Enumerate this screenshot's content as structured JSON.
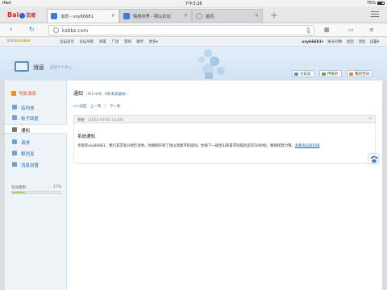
{
  "status_bar": {
    "device": "iPad",
    "time": "下午3:26",
    "battery": "75%"
  },
  "browser": {
    "logo": {
      "bai": "Bai",
      "du": "百度"
    },
    "tabs": [
      {
        "label": "消息 - sxy66681",
        "favicon": "page-icon",
        "color": "#3b7bd8",
        "active": true
      },
      {
        "label": "情感世界 - 昆山论坛",
        "favicon": "page-icon",
        "color": "#3b7bd8",
        "active": false
      },
      {
        "label": "首页",
        "favicon": "globe-icon",
        "color": "#999999",
        "active": false
      }
    ],
    "add_tab": "+",
    "url": "ksbbs.com"
  },
  "site_nav": {
    "brand": "KUNSHAN",
    "links": [
      "论坛首页",
      "论坛导航",
      "商家",
      "广场",
      "游戏",
      "群币",
      "更多▾"
    ],
    "user": "sxy66681",
    "user_arrow": "▾",
    "user_links": [
      "账号切换",
      "退出",
      "消息",
      "设置▾"
    ]
  },
  "banner": {
    "title": "消息",
    "subtitle": "返回个人中心",
    "buttons": [
      "写日志",
      "传照片",
      "我的空间"
    ]
  },
  "sidebar": {
    "write": "写新消息",
    "items": [
      {
        "label": "站内信",
        "icon": "mail-icon",
        "active": false
      },
      {
        "label": "帖子回复",
        "icon": "reply-icon",
        "active": false
      },
      {
        "label": "通知",
        "icon": "bell-icon",
        "active": true
      },
      {
        "label": "请求",
        "icon": "request-icon",
        "active": false
      },
      {
        "label": "群消息",
        "icon": "group-icon",
        "active": false
      },
      {
        "label": "消息设置",
        "icon": "settings-icon",
        "active": false
      }
    ],
    "space_label": "空间使用",
    "space_percent": "27%",
    "space_fill": 0.27
  },
  "content": {
    "title": "通知",
    "count": "(共158条,",
    "unread": "0条未读通知)",
    "pager": {
      "back": "<<返回",
      "prev": "上一条",
      "sep": "|",
      "next": "下一条"
    },
    "message": {
      "sender": "系统",
      "time": "(2015-03-01 13:06)",
      "close": "×",
      "subject": "系统通知",
      "body": "亲爱的sxy66681，我们非常高兴地告诉你，你刚刚升到了昆山高能市民级别。你离下一级昆山荣誉市民级别还有5000帖，要继续努力哦，",
      "link": "查看会员组权限"
    }
  }
}
